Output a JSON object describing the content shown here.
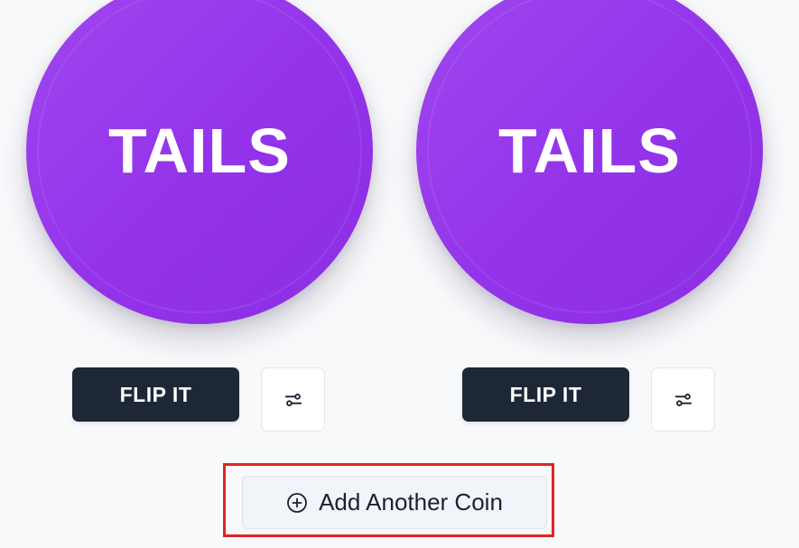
{
  "coins": [
    {
      "face": "TAILS",
      "flip_label": "FLIP IT",
      "settings_icon": "sliders-icon"
    },
    {
      "face": "TAILS",
      "flip_label": "FLIP IT",
      "settings_icon": "sliders-icon"
    }
  ],
  "add_coin": {
    "label": "Add Another Coin",
    "icon": "plus-circle-icon"
  },
  "colors": {
    "background": "#f8f9fb",
    "coin": "#9333ea",
    "flip_button": "#1e2735",
    "highlight": "#e02424"
  }
}
